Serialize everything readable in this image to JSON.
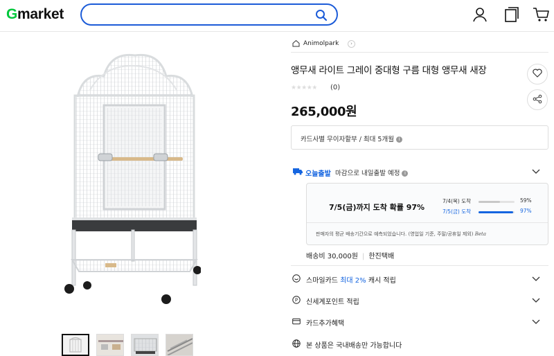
{
  "header": {
    "logo": {
      "g": "G",
      "rest": "market"
    },
    "search_value": "",
    "icons": [
      "search-icon",
      "user-icon",
      "recent-items-icon",
      "cart-icon"
    ]
  },
  "product": {
    "store": "Animolpark",
    "title": "앵무새 라이트 그레이 중대형 구름 대형 앵무새 새장",
    "stars": "★★★★★",
    "review_count": "(0)",
    "price": "265,000원",
    "rating": 0
  },
  "card_installment": "카드사별 무이자할부 / 최대 5개월",
  "shipping": {
    "badge": "오늘출발",
    "message": "마감으로 내일출발 예정",
    "probability_text": "7/5(금)까지 도착 확률 97%",
    "bars": [
      {
        "label": "7/4(목) 도착",
        "pct_text": "59%",
        "value": 0.59
      },
      {
        "label": "7/5(금) 도착",
        "pct_text": "97%",
        "value": 0.97
      }
    ],
    "note": "판매자의 평균 배송기간으로 예측되었습니다. (영업일 기준, 주말/공휴일 제외)",
    "note_tag": "Beta",
    "fee": "배송비 30,000원",
    "carrier": "한진택배"
  },
  "benefits": [
    {
      "pre": "스마일카드 ",
      "highlight": "최대 2%",
      "post": " 캐시 적립",
      "icon": "smile-card-icon"
    },
    {
      "pre": "신세계포인트 적립",
      "highlight": "",
      "post": "",
      "icon": "point-p-icon"
    },
    {
      "pre": "카드추가혜택",
      "highlight": "",
      "post": "",
      "icon": "card-icon"
    },
    {
      "pre": "본 상품은 국내배송만 가능합니다",
      "highlight": "",
      "post": "",
      "icon": "globe-icon"
    }
  ],
  "colors": {
    "accent": "#1b5bd8",
    "blue_text": "#1565e0",
    "logo_green": "#00c73c"
  }
}
